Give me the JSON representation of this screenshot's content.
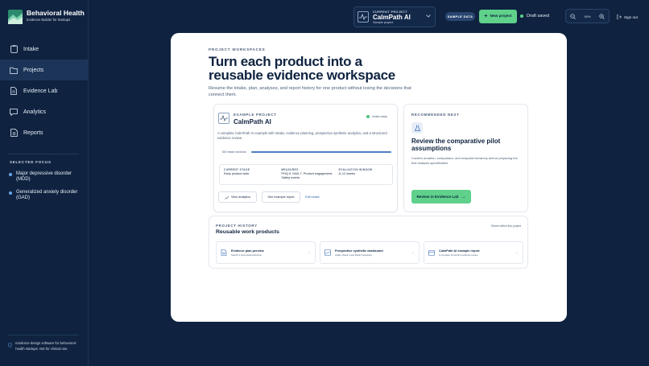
{
  "brand": {
    "title": "Behavioral Health",
    "subtitle": "Evidence Builder for Startups"
  },
  "nav": {
    "items": [
      {
        "label": "Intake",
        "icon": "clipboard-icon"
      },
      {
        "label": "Projects",
        "icon": "folder-icon"
      },
      {
        "label": "Evidence Lab",
        "icon": "document-icon"
      },
      {
        "label": "Analytics",
        "icon": "chat-icon"
      },
      {
        "label": "Reports",
        "icon": "report-icon"
      }
    ]
  },
  "focus": {
    "title": "SELECTED FOCUS",
    "items": [
      "Major depressive disorder (MDD)",
      "Generalized anxiety disorder (GAD)"
    ]
  },
  "footer": {
    "text": "Evidence-design software for behavioral-health startups. Not for clinical use."
  },
  "topbar": {
    "project_label": "CURRENT PROJECT",
    "project_name": "CalmPath AI",
    "project_sub": "Sample project",
    "sample_button": "SAMPLE DATA",
    "new_button": "New project",
    "saved": "Draft saved",
    "zoom": "90%",
    "signout": "Sign out"
  },
  "workspace": {
    "label": "PROJECT WORKSPACES",
    "title": "Turn each product into a reusable evidence workspace",
    "description": "Resume the intake, plan, analyses, and report history for one product without losing the decisions that connect them."
  },
  "example": {
    "label": "EXAMPLE PROJECT",
    "name": "CalmPath AI",
    "ready": "Intake ready",
    "description": "A complete CalmPath AI example with intake, evidence planning, prospective synthetic analytics, and a structured evidence review.",
    "progress_label": "6/6 intake sections",
    "progress_fraction": 1.0,
    "stats": [
      {
        "label": "CURRENT STAGE",
        "value": "Early product data"
      },
      {
        "label": "MEASURES",
        "value": "PHQ-9, GAD-7, Product engagement, Safety events"
      },
      {
        "label": "EVALUATION WINDOW",
        "value": "8–12 weeks"
      }
    ],
    "actions": {
      "view": "View analytics",
      "report": "See example report",
      "edit": "Edit intake"
    }
  },
  "recommended": {
    "label": "RECOMMENDED NEXT",
    "title": "Review the comparative pilot assumptions",
    "description": "Confirm duration, comparator, and endpoint hierarchy before preparing the first analysis specification.",
    "button": "Review in Evidence Lab"
  },
  "history": {
    "label": "PROJECT HISTORY",
    "title": "Reusable work products",
    "note": "Stored within this project",
    "items": [
      {
        "title": "Evidence plan preview",
        "sub": "Search 2 input-based direction",
        "icon": "document-icon"
      },
      {
        "title": "Prospective synthetic dashboard",
        "sub": "Intake, Week 4 and Week 8 analytics",
        "icon": "chart-icon"
      },
      {
        "title": "CalmPath AI example report",
        "sub": "A complete 10-section evidence review",
        "icon": "report-icon"
      }
    ]
  },
  "colors": {
    "navy": "#0f2340",
    "accent_green": "#5fd18b",
    "link_blue": "#2e64b3"
  }
}
